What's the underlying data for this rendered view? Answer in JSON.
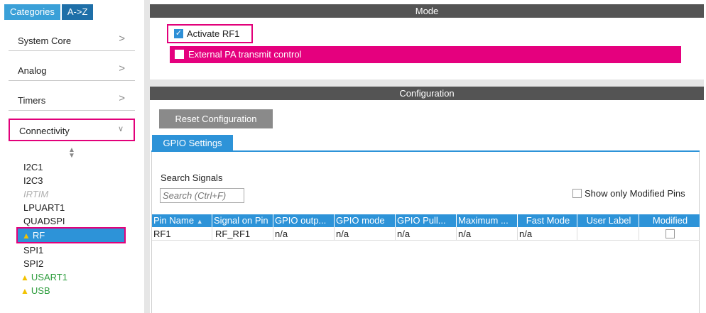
{
  "tabs": {
    "categories": "Categories",
    "az": "A->Z"
  },
  "categories": [
    "System Core",
    "Analog",
    "Timers",
    "Connectivity"
  ],
  "chevrons": {
    "collapsed": ">",
    "expanded": "∨"
  },
  "connectivity_items": [
    {
      "label": "I2C1",
      "state": "normal"
    },
    {
      "label": "I2C3",
      "state": "normal"
    },
    {
      "label": "IRTIM",
      "state": "disabled"
    },
    {
      "label": "LPUART1",
      "state": "normal"
    },
    {
      "label": "QUADSPI",
      "state": "normal"
    },
    {
      "label": "RF",
      "state": "selected-warning"
    },
    {
      "label": "SPI1",
      "state": "normal"
    },
    {
      "label": "SPI2",
      "state": "normal"
    },
    {
      "label": "USART1",
      "state": "warning"
    },
    {
      "label": "USB",
      "state": "warning"
    }
  ],
  "mode": {
    "title": "Mode",
    "activate_label": "Activate RF1",
    "activate_checked": true,
    "external_label": "External PA transmit control",
    "external_checked": false
  },
  "configuration": {
    "title": "Configuration",
    "reset_label": "Reset Configuration",
    "gpio_tab": "GPIO Settings",
    "search_label": "Search Signals",
    "search_placeholder": "Search (Ctrl+F)",
    "show_modified_label": "Show only Modified Pins",
    "columns": [
      "Pin Name",
      "Signal on Pin",
      "GPIO outp...",
      "GPIO mode",
      "GPIO Pull...",
      "Maximum ...",
      "Fast Mode",
      "User Label",
      "Modified"
    ],
    "rows": [
      {
        "pin": "RF1",
        "signal": "RF_RF1",
        "gpio_output": "n/a",
        "gpio_mode": "n/a",
        "gpio_pull": "n/a",
        "maximum": "n/a",
        "fast_mode": "n/a",
        "user_label": "",
        "modified": false
      }
    ]
  },
  "colors": {
    "accent": "#2d93d8",
    "highlight": "#e2007a",
    "warning": "#f2c200",
    "ok_text": "#2e9d3d",
    "bar": "#545454"
  }
}
